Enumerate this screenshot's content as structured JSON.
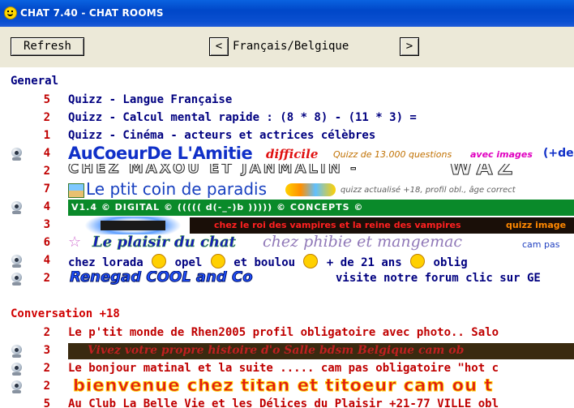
{
  "window": {
    "title": "CHAT 7.40 - CHAT ROOMS"
  },
  "toolbar": {
    "refresh_label": "Refresh",
    "prev_label": "<",
    "next_label": ">",
    "language": "Français/Belgique"
  },
  "sections": [
    {
      "title": "General"
    },
    {
      "title": "Conversation +18"
    }
  ],
  "general_rooms": [
    {
      "count": "5",
      "name": "Quizz - Langue Française"
    },
    {
      "count": "2",
      "name": "Quizz - Calcul mental rapide : (8 * 8) - (11 * 3) ="
    },
    {
      "count": "1",
      "name": "Quizz - Cinéma - acteurs et actrices célèbres"
    },
    {
      "count": "4",
      "banner": {
        "t1": "AuCoeurDe L'Amitie",
        "t2": "difficile",
        "t3": "Quizz de 13.000 questions",
        "t4": "avec images",
        "t5": "(+de"
      }
    },
    {
      "count": "2",
      "banner": {
        "t1": "CHEZ MAXOU ET JANMALIN -",
        "t2": "WAZ"
      }
    },
    {
      "count": "7",
      "banner": {
        "t1": "Le ptit coin de paradis",
        "t2": "quizz actualisé +18, profil obl., âge correct"
      }
    },
    {
      "count": "4",
      "banner": {
        "t1": "V1.4  ©  DIGITAL  ©  ((((( d(-_-)b )))))  ©  CONCEPTS  ©"
      }
    },
    {
      "count": "3",
      "banner": {
        "t1": "chez le roi des vampires et la reine des vampires",
        "t2": "quizz image"
      }
    },
    {
      "count": "6",
      "banner": {
        "t1": "Le plaisir du chat",
        "t2": "chez phibie et mangemac",
        "t3": "cam pas"
      }
    },
    {
      "count": "4",
      "parts": [
        "chez lorada",
        "opel",
        "et boulou",
        "+ de 21 ans",
        "oblig"
      ]
    },
    {
      "count": "2",
      "banner": {
        "t1": "Renegad COOL and Co"
      },
      "tail": "visite notre forum clic sur GE"
    }
  ],
  "conversation_rooms": [
    {
      "count": "2",
      "name": "Le p'tit monde de Rhen2005 profil obligatoire avec photo.. Salo"
    },
    {
      "count": "3",
      "banner": {
        "t1": "Vivez votre propre histoire d'o Salle bdsm Belgique cam ob"
      }
    },
    {
      "count": "2",
      "name": "Le bonjour matinal et la suite ..... cam pas obligatoire \"hot c"
    },
    {
      "count": "2",
      "banner": {
        "t1": "bienvenue chez titan et titoeur cam ou t"
      }
    },
    {
      "count": "5",
      "name": "Au Club La Belle Vie et les Délices du Plaisir +21-77 VILLE obl"
    }
  ]
}
